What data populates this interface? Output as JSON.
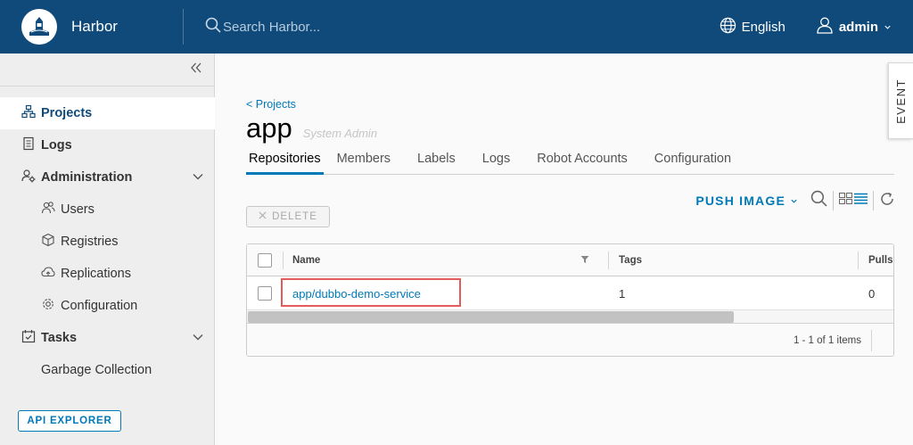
{
  "header": {
    "brand": "Harbor",
    "search_placeholder": "Search Harbor...",
    "language": "English",
    "user": "admin"
  },
  "sidebar": {
    "items": [
      {
        "label": "Projects",
        "icon": "projects-icon",
        "active": true
      },
      {
        "label": "Logs",
        "icon": "logs-icon"
      },
      {
        "label": "Administration",
        "icon": "administration-icon",
        "expanded": true
      },
      {
        "label": "Users",
        "icon": "users-icon"
      },
      {
        "label": "Registries",
        "icon": "registries-icon"
      },
      {
        "label": "Replications",
        "icon": "replications-icon"
      },
      {
        "label": "Configuration",
        "icon": "configuration-icon"
      },
      {
        "label": "Tasks",
        "icon": "tasks-icon",
        "expanded": true
      },
      {
        "label": "Garbage Collection"
      }
    ],
    "api_explorer": "API EXPLORER"
  },
  "main": {
    "back_link": "< Projects",
    "title": "app",
    "role": "System Admin",
    "event_tab": "EVENT",
    "tabs": [
      {
        "label": "Repositories",
        "active": true
      },
      {
        "label": "Members"
      },
      {
        "label": "Labels"
      },
      {
        "label": "Logs"
      },
      {
        "label": "Robot Accounts"
      },
      {
        "label": "Configuration"
      }
    ],
    "push_image": "PUSH IMAGE",
    "delete": "DELETE",
    "table": {
      "columns": [
        "Name",
        "Tags",
        "Pulls"
      ],
      "rows": [
        {
          "name": "app/dubbo-demo-service",
          "tags": "1",
          "pulls": "0"
        }
      ],
      "footer": "1 - 1 of 1 items"
    }
  },
  "colors": {
    "header_bg": "#0f4a7a",
    "accent": "#0079b8",
    "highlight_box": "#e35b5b"
  }
}
